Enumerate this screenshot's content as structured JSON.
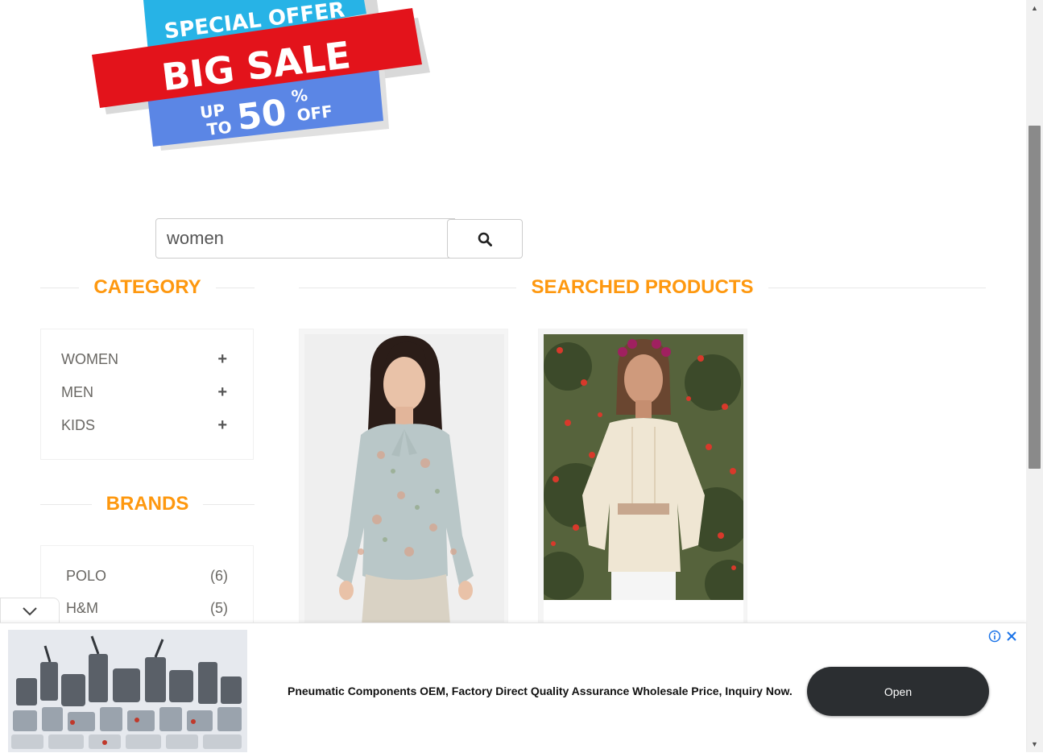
{
  "banner": {
    "line1": "SPECIAL OFFER",
    "line2": "BIG SALE",
    "up": "UP",
    "to": "TO",
    "percent_value": "50",
    "percent_sign": "%",
    "off": "OFF"
  },
  "search": {
    "value": "women",
    "button_icon": "search-icon"
  },
  "category": {
    "title": "CATEGORY",
    "items": [
      {
        "label": "WOMEN",
        "icon": "plus-icon"
      },
      {
        "label": "MEN",
        "icon": "plus-icon"
      },
      {
        "label": "KIDS",
        "icon": "plus-icon"
      }
    ]
  },
  "brands": {
    "title": "BRANDS",
    "items": [
      {
        "label": "POLO",
        "count": "(6)"
      },
      {
        "label": "H&M",
        "count": "(5)"
      }
    ]
  },
  "products": {
    "title": "SEARCHED PRODUCTS"
  },
  "ad": {
    "text": "Pneumatic Components OEM, Factory Direct Quality Assurance Wholesale Price, Inquiry Now.",
    "button": "Open",
    "info_icon": "info-icon",
    "close_icon": "close-icon",
    "collapse_icon": "chevron-down-icon"
  },
  "colors": {
    "accent": "#fe980f",
    "banner_red": "#e3131b",
    "banner_cyan": "#27b3e6",
    "banner_blue": "#5b86e5"
  }
}
